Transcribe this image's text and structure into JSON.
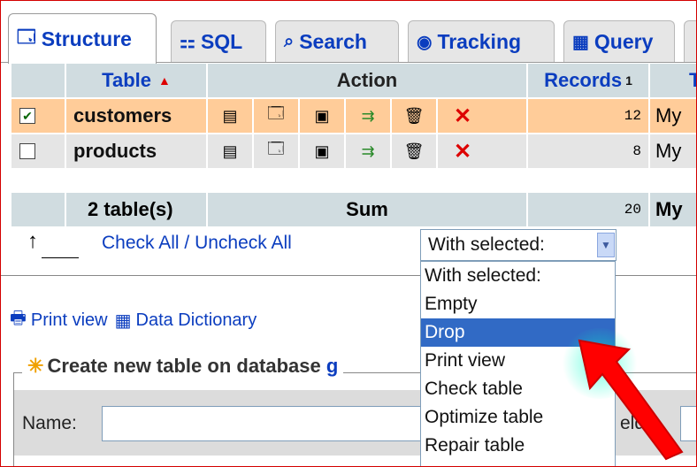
{
  "tabs": [
    {
      "label": "Structure",
      "icon": "structure-icon",
      "glyph": "🗔"
    },
    {
      "label": "SQL",
      "icon": "sql-icon",
      "glyph": "⚏"
    },
    {
      "label": "Search",
      "icon": "search-icon",
      "glyph": "⌕"
    },
    {
      "label": "Tracking",
      "icon": "tracking-icon",
      "glyph": "◉"
    },
    {
      "label": "Query",
      "icon": "query-icon",
      "glyph": "▦"
    }
  ],
  "table": {
    "headers": {
      "table": "Table",
      "sort_glyph": "▲",
      "action": "Action",
      "records": "Records",
      "records_sup": "1",
      "type": "T"
    },
    "rows": [
      {
        "checked": "✔",
        "name": "customers",
        "records": "12",
        "type": "My"
      },
      {
        "checked": "",
        "name": "products",
        "records": "8",
        "type": "My"
      }
    ],
    "summary": {
      "count": "2 table(s)",
      "sum": "Sum",
      "records": "20",
      "type": "My"
    }
  },
  "check_all": {
    "check": "Check All",
    "separator": " / ",
    "uncheck": "Uncheck All"
  },
  "with_selected": {
    "value": "With selected:",
    "options": [
      "With selected:",
      "Empty",
      "Drop",
      "Print view",
      "Check table",
      "Optimize table",
      "Repair table"
    ],
    "highlighted": "Drop"
  },
  "links": {
    "print_view": "Print view",
    "data_dictionary": "Data Dictionary"
  },
  "create_table": {
    "legend": "Create new table on database",
    "db_partial": "g",
    "name_label": "Name:",
    "fields_label": "elds:"
  },
  "colors": {
    "highlight_row": "#ffcc99",
    "header": "#d0dce0",
    "selection": "#316ac5",
    "link": "#0b3dbf",
    "arrow": "#ff0000"
  }
}
